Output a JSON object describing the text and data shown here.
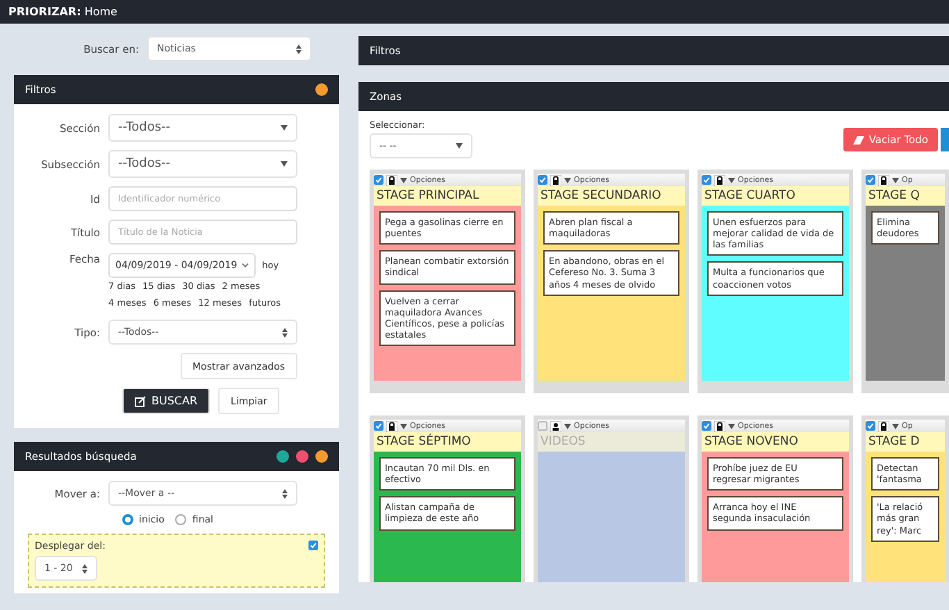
{
  "header": {
    "app": "PRIORIZAR:",
    "page": "Home"
  },
  "search_in": {
    "label": "Buscar en:",
    "value": "Noticias"
  },
  "filters": {
    "title": "Filtros",
    "fields": [
      {
        "kind": "select",
        "label": "Sección",
        "value": "--Todos--"
      },
      {
        "kind": "select",
        "label": "Subsección",
        "value": "--Todos--"
      },
      {
        "kind": "input",
        "label": "Id",
        "placeholder": "Identificador numérico"
      },
      {
        "kind": "input",
        "label": "Título",
        "placeholder": "Título de la Noticia"
      },
      {
        "kind": "date",
        "label": "Fecha",
        "value": "04/09/2019 - 04/09/2019",
        "links": [
          "hoy",
          "7 dias",
          "15 dias",
          "30 dias",
          "2 meses",
          "4 meses",
          "6 meses",
          "12 meses",
          "futuros"
        ]
      },
      {
        "kind": "native",
        "label": "Tipo:",
        "value": "--Todos--"
      }
    ],
    "advanced": "Mostrar avanzados",
    "search": "BUSCAR",
    "clear": "Limpiar"
  },
  "results": {
    "title": "Resultados búsqueda",
    "move": {
      "label": "Mover a:",
      "value": "--Mover a --"
    },
    "positions": [
      {
        "label": "inicio",
        "selected": true
      },
      {
        "label": "final",
        "selected": false
      }
    ],
    "display": {
      "label": "Desplegar del:",
      "checked": true,
      "value": "1 - 20"
    }
  },
  "right_filters": {
    "title": "Filtros"
  },
  "zones": {
    "title": "Zonas",
    "select": {
      "label": "Seleccionar:",
      "value": "-- --"
    },
    "clear_all": "Vaciar Todo",
    "rows": [
      [
        {
          "checked": true,
          "kind": "lock",
          "options": "Opciones",
          "title": "STAGE PRINCIPAL",
          "color": "#ff9a9a",
          "disabled": false,
          "cards": [
            "Pega a gasolinas cierre en puentes",
            "Planean combatir extorsión sindical",
            "Vuelven a cerrar maquiladora Avances Científicos, pese a policías estatales"
          ]
        },
        {
          "checked": true,
          "kind": "lock",
          "options": "Opciones",
          "title": "STAGE SECUNDARIO",
          "color": "#ffe27a",
          "disabled": false,
          "cards": [
            "Abren plan fiscal a maquiladoras",
            "En abandono, obras en el Cefereso No. 3. Suma 3 años 4 meses de olvido"
          ]
        },
        {
          "checked": true,
          "kind": "lock",
          "options": "Opciones",
          "title": "STAGE CUARTO",
          "color": "#5ffdff",
          "disabled": false,
          "cards": [
            "Unen esfuerzos para mejorar calidad de vida de las familias",
            "Multa a funcionarios que coaccionen votos"
          ]
        },
        {
          "checked": true,
          "kind": "lock",
          "options": "Op",
          "title": "STAGE Q",
          "color": "#808080",
          "disabled": false,
          "cards": [
            "Elimina\ndeudores"
          ]
        }
      ],
      [
        {
          "checked": true,
          "kind": "lock",
          "options": "Opciones",
          "title": "STAGE SÉPTIMO",
          "color": "#2bb94f",
          "disabled": false,
          "cards": [
            "Incautan 70 mil Dls. en efectivo",
            "Alistan campaña de limpieza de este año"
          ]
        },
        {
          "checked": false,
          "kind": "user",
          "options": "Opciones",
          "title": "VIDEOS",
          "color": "#b8c7e3",
          "disabled": true
        },
        {
          "checked": true,
          "kind": "lock",
          "options": "Opciones",
          "title": "STAGE NOVENO",
          "color": "#ff9a9a",
          "disabled": false,
          "cards": [
            "Prohíbe juez de EU regresar migrantes",
            "Arranca hoy el INE segunda insaculación"
          ]
        },
        {
          "checked": true,
          "kind": "lock",
          "options": "Op",
          "title": "STAGE D",
          "color": "#ffe27a",
          "disabled": false,
          "cards": [
            "Detectan\n'fantasma",
            "'La relació\nmás gran\nrey': Marc"
          ]
        }
      ]
    ]
  }
}
